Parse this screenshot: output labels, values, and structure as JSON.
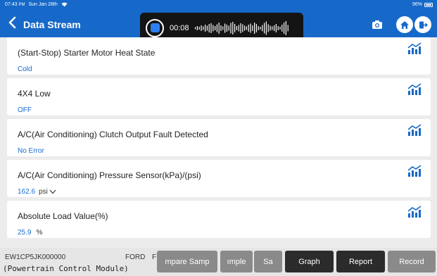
{
  "status": {
    "time": "07:43",
    "ampm": "PM",
    "date": "Sun Jan 28th",
    "battery": "96%"
  },
  "header": {
    "title": "Data Stream"
  },
  "recording": {
    "time": "00:08"
  },
  "rows": [
    {
      "name": "(Start-Stop) Starter Motor Heat State",
      "value": "Cold",
      "unit": ""
    },
    {
      "name": "4X4 Low",
      "value": "OFF",
      "unit": ""
    },
    {
      "name": "A/C(Air Conditioning) Clutch Output Fault Detected",
      "value": "No Error",
      "unit": ""
    },
    {
      "name": "A/C(Air Conditioning) Pressure Sensor(kPa)/(psi)",
      "value": "162.6",
      "unit": "psi"
    },
    {
      "name": "Absolute Load Value(%)",
      "value": "25.9",
      "unit": "%"
    }
  ],
  "footer": {
    "vin": "EW1CP5JK000000",
    "make": "FORD",
    "make_extra": "F",
    "module": "(Powertrain Control Module)",
    "buttons": {
      "compare": "mpare Samp",
      "sample": "ımple",
      "save": "Sa",
      "graph": "Graph",
      "report": "Report",
      "record": "Record"
    }
  },
  "colors": {
    "header": "#1669c9",
    "value": "#1a6ad0",
    "accent": "#2d7ff0"
  }
}
